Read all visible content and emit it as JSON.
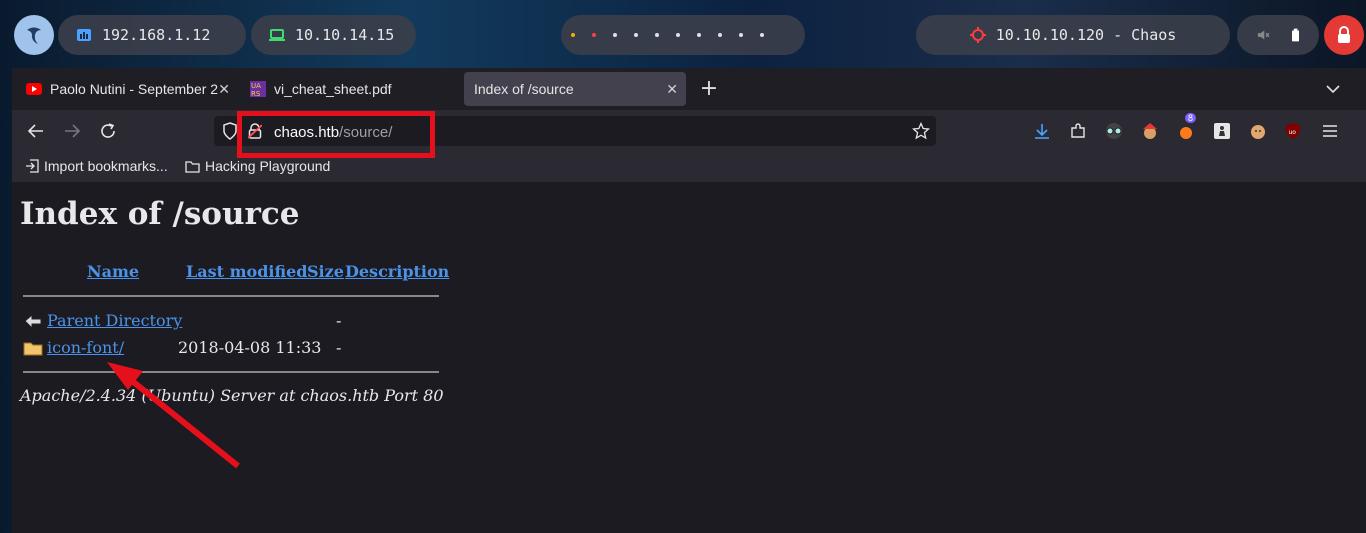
{
  "system_bar": {
    "lan_ip": "192.168.1.12",
    "vpn_ip": "10.10.14.15",
    "target": "10.10.10.120 - Chaos"
  },
  "tabs": [
    {
      "label": "Paolo Nutini - September 2",
      "icon": "youtube-icon"
    },
    {
      "label": "vi_cheat_sheet.pdf",
      "icon": "pdf-icon"
    },
    {
      "label": "Index of /source",
      "active": true
    }
  ],
  "url": {
    "host": "chaos.htb",
    "path": "/source/"
  },
  "toolbar": {
    "extension_badge": "8"
  },
  "bookmarks": [
    {
      "label": "Import bookmarks..."
    },
    {
      "label": "Hacking Playground"
    }
  ],
  "page": {
    "title": "Index of /source",
    "headers": {
      "name": "Name",
      "modified": "Last modified",
      "size": "Size",
      "description": "Description"
    },
    "rows": [
      {
        "name": "Parent Directory",
        "modified": "",
        "size": "-"
      },
      {
        "name": "icon-font/",
        "modified": "2018-04-08 11:33",
        "size": "-"
      }
    ],
    "footer": "Apache/2.4.34 (Ubuntu) Server at chaos.htb Port 80"
  },
  "colors": {
    "accent": "#e5101b",
    "link": "#4b93e8",
    "page_bg": "#1c1b22"
  }
}
